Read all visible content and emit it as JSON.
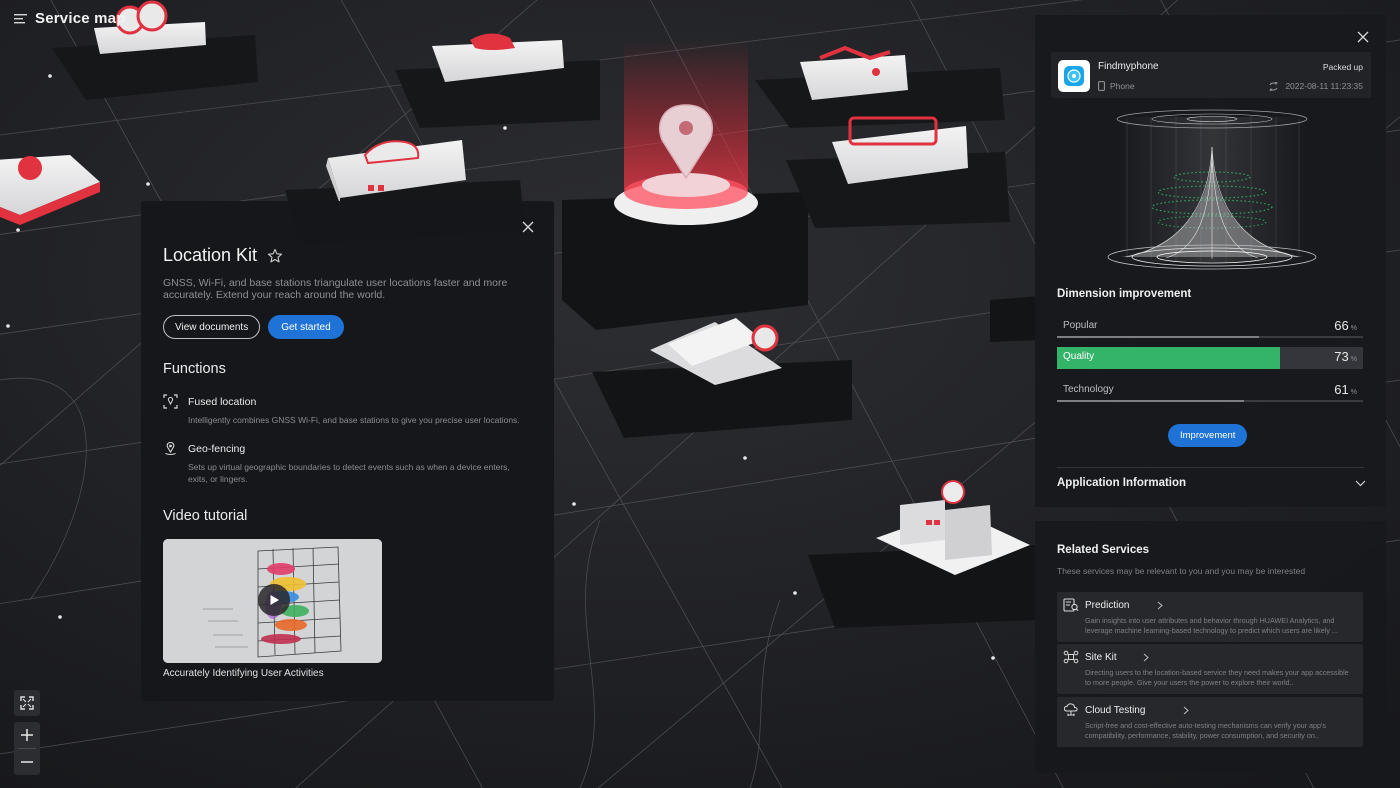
{
  "header": {
    "title": "Service map",
    "menu_icon": "menu-list-icon"
  },
  "zoom": {
    "fit_icon": "fullscreen-icon",
    "in_icon": "plus-icon",
    "out_icon": "minus-icon"
  },
  "location_kit": {
    "title": "Location Kit",
    "favorite_icon": "star-icon",
    "description": "GNSS, Wi-Fi, and base stations triangulate user locations faster and more accurately. Extend your reach around the world.",
    "view_documents_label": "View documents",
    "get_started_label": "Get started",
    "functions_title": "Functions",
    "functions": [
      {
        "icon": "location-scan-icon",
        "name": "Fused location",
        "description": "Intelligently combines GNSS Wi-Fi, and base stations to give you precise user locations."
      },
      {
        "icon": "geo-pin-icon",
        "name": "Geo-fencing",
        "description": "Sets up virtual geographic boundaries to detect events such as when a device enters, exits, or lingers."
      }
    ],
    "video_title": "Video tutorial",
    "video_caption": "Accurately Identifying User Activities",
    "accent_color": "#1f73d6"
  },
  "app_panel": {
    "app_name": "Findmyphone",
    "device": "Phone",
    "status": "Packed up",
    "timestamp": "2022-08-11   11:23:35",
    "dimension_title": "Dimension improvement",
    "metrics": [
      {
        "label": "Popular",
        "value": "66",
        "unit": "%",
        "fraction": 0.66
      },
      {
        "label": "Quality",
        "value": "73",
        "unit": "%",
        "fraction": 0.73,
        "active": true
      },
      {
        "label": "Technology",
        "value": "61",
        "unit": "%",
        "fraction": 0.61
      }
    ],
    "improvement_label": "Improvement",
    "app_info_label": "Application Information",
    "highlight_color": "#33b468"
  },
  "related": {
    "title": "Related Services",
    "subtitle": "These services may be relevant to you and you may be interested",
    "services": [
      {
        "icon": "prediction-icon",
        "name": "Prediction",
        "description": "Gain insights into user attributes and behavior through HUAWEI Analytics, and leverage machine learning-based technology to predict which users are likely ..."
      },
      {
        "icon": "site-kit-icon",
        "name": "Site Kit",
        "description": "Directing users to the location-based service they need makes your app accessible to more people. Give your users the power to explore their world.."
      },
      {
        "icon": "cloud-testing-icon",
        "name": "Cloud Testing",
        "description": "Script-free and cost-effective auto-testing mechanisms can verify your app's compatibility, performance, stability, power consumption, and security on.."
      }
    ]
  }
}
